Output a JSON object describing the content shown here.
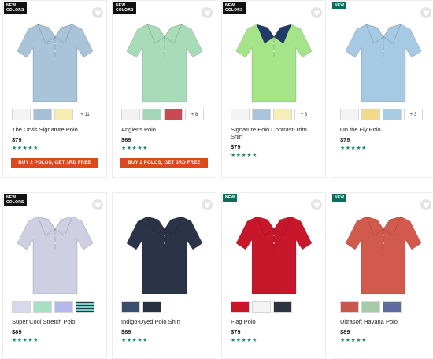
{
  "products": [
    {
      "name": "The Orvis Signature Polo",
      "price": "$79",
      "badge": "NEW\nCOLORS",
      "badge_type": "colors",
      "stars": "★★★★★",
      "shirt_color": "#a9c4d9",
      "collar_color": "#a9c4d9",
      "swatches": [
        "#f3f3f3",
        "#a5c0d6",
        "#f5ecb0"
      ],
      "more": "+ 11",
      "promo": "BUY 2 POLOS, GET 3RD FREE"
    },
    {
      "name": "Angler's Polo",
      "price": "$69",
      "badge": "NEW\nCOLORS",
      "badge_type": "colors",
      "stars": "★★★★★",
      "shirt_color": "#a8dcb9",
      "collar_color": "#a8dcb9",
      "swatches": [
        "#f2f2f2",
        "#a4d7b7",
        "#c94a52"
      ],
      "more": "+ 8",
      "promo": "BUY 2 POLOS, GET 3RD FREE"
    },
    {
      "name": "Signature Polo Contrast-Trim Shirt",
      "price": "$79",
      "badge": "NEW\nCOLORS",
      "badge_type": "colors",
      "stars": "★★★★★",
      "shirt_color": "#a6e48a",
      "collar_color": "#1f3b66",
      "swatches": [
        "#f3f3f3",
        "#a9c5dc",
        "#f5eeb8"
      ],
      "more": "+ 3",
      "promo": ""
    },
    {
      "name": "On the Fly Polo",
      "price": "$79",
      "badge": "NEW",
      "badge_type": "new",
      "stars": "★★★★★",
      "shirt_color": "#a6c9e4",
      "collar_color": "#a6c9e4",
      "swatches": [
        "#f3f3f3",
        "#f4d98c",
        "#a8cbe6"
      ],
      "more": "+ 3",
      "promo": ""
    },
    {
      "name": "Super Cool Stretch Polo",
      "price": "$89",
      "badge": "NEW\nCOLORS",
      "badge_type": "colors",
      "stars": "★★★★★",
      "shirt_color": "#cfcfe3",
      "collar_color": "#cfcfe3",
      "swatches": [
        "#d8d8ec",
        "#a6e0c4",
        "#b4b8ea",
        "stripe"
      ],
      "more": "",
      "promo": ""
    },
    {
      "name": "Indigo-Dyed Polo Shirt",
      "price": "$89",
      "badge": "",
      "badge_type": "",
      "stars": "★★★★★",
      "shirt_color": "#2b3446",
      "collar_color": "#2b3446",
      "swatches": [
        "#3a4d6e",
        "#26303e"
      ],
      "more": "",
      "promo": ""
    },
    {
      "name": "Flag Polo",
      "price": "$79",
      "badge": "NEW",
      "badge_type": "new",
      "stars": "★★★★★",
      "shirt_color": "#c8172b",
      "collar_color": "#c8172b",
      "swatches": [
        "#c8172b",
        "#f4f4f4",
        "#2d3340"
      ],
      "more": "",
      "promo": ""
    },
    {
      "name": "Ultrasoft Havana Polo",
      "price": "$89",
      "badge": "NEW",
      "badge_type": "new",
      "stars": "★★★★★",
      "shirt_color": "#d25a4c",
      "collar_color": "#d25a4c",
      "swatches": [
        "#c9574c",
        "#a6c9a8",
        "#5d6b9e"
      ],
      "more": "",
      "promo": ""
    }
  ]
}
